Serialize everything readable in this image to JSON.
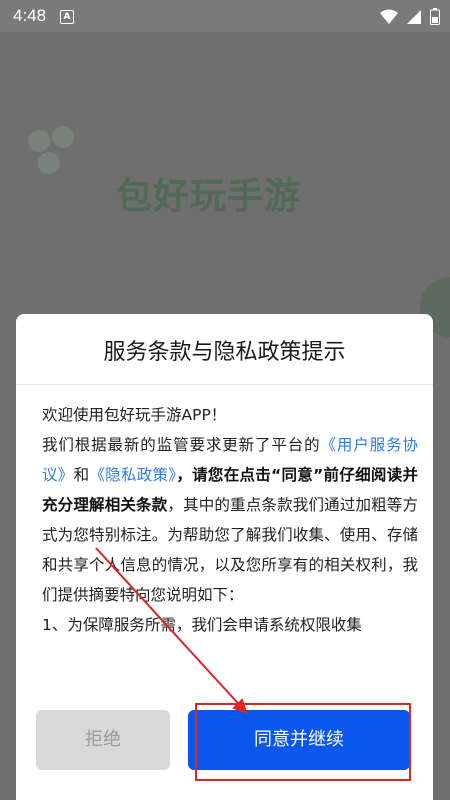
{
  "status_bar": {
    "time": "4:48",
    "indicator": "A",
    "icons": [
      "wifi-icon",
      "signal-icon",
      "battery-icon"
    ]
  },
  "splash": {
    "app_name": "包好玩手游"
  },
  "dialog": {
    "title": "服务条款与隐私政策提示",
    "paragraphs": {
      "p1": "欢迎使用包好玩手游APP！",
      "p2_text1": "我们根据最新的监管要求更新了平台的",
      "p2_link1": "《用户服务协议》",
      "p2_text2": "和",
      "p2_link2": "《隐私政策》",
      "p2_strong": "，请您在点击“同意”前仔细阅读并充分理解相关条款",
      "p2_text3": "，其中的重点条款我们通过加粗等方式为您特别标注。为帮助您了解我们收集、使用、存储和共享个人信息的情况，以及您所享有的相关权利，我们提供摘要特向您说明如下：",
      "p3": "1、为保障服务所需，我们会申请系统权限收集"
    },
    "reject_label": "拒绝",
    "agree_label": "同意并继续"
  },
  "colors": {
    "link": "#2d7bf0",
    "agree_button": "#0b57ee",
    "reject_button": "#d9d9d9",
    "annotation": "#e02424"
  }
}
